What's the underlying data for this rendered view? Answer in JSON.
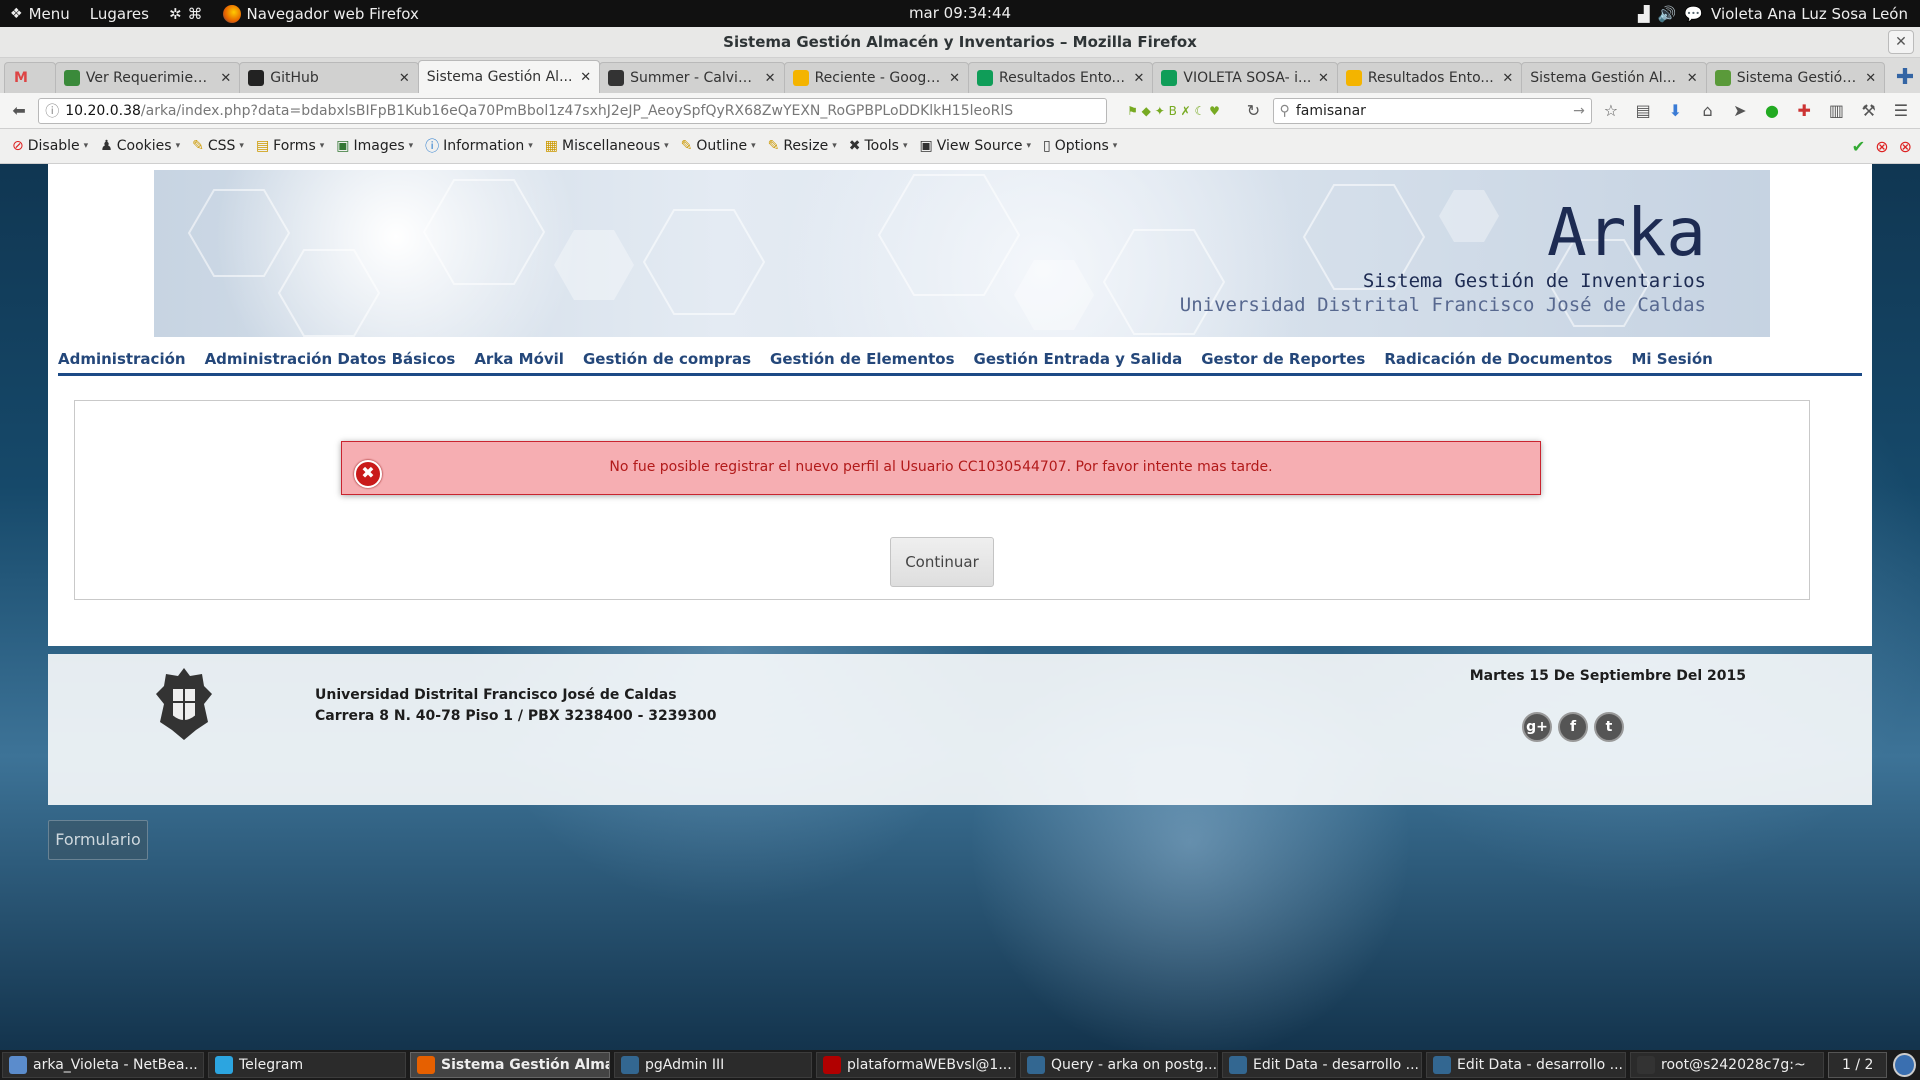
{
  "panel": {
    "menu_label": "Menu",
    "places_label": "Lugares",
    "app_label": "Navegador web Firefox",
    "clock": "mar 09:34:44",
    "user": "Violeta Ana Luz Sosa León"
  },
  "window": {
    "title": "Sistema Gestión Almacén y Inventarios – Mozilla Firefox",
    "close": "✕"
  },
  "tabs": [
    {
      "title": "",
      "icon_color": "#ffffff",
      "icon": "gmail-icon",
      "close": ""
    },
    {
      "title": "Ver Requerimien...",
      "icon_color": "#3a8a3a",
      "icon": "puzzle-icon",
      "close": "✕"
    },
    {
      "title": "GitHub",
      "icon_color": "#222222",
      "icon": "github-icon",
      "close": "✕"
    },
    {
      "title": "Sistema Gestión Al...",
      "icon_color": "#f5f5f4",
      "icon": "",
      "close": "✕",
      "active": true
    },
    {
      "title": "Summer - Calvin ...",
      "icon_color": "#333333",
      "icon": "media-icon",
      "close": "✕"
    },
    {
      "title": "Reciente - Googl...",
      "icon_color": "#f4b400",
      "icon": "drive-icon",
      "close": "✕"
    },
    {
      "title": "Resultados Ento...",
      "icon_color": "#0f9d58",
      "icon": "sheets-icon",
      "close": "✕"
    },
    {
      "title": "VIOLETA SOSA- i...",
      "icon_color": "#0f9d58",
      "icon": "sheets-icon",
      "close": "✕"
    },
    {
      "title": "Resultados Ento...",
      "icon_color": "#f4b400",
      "icon": "drive-icon",
      "close": "✕"
    },
    {
      "title": "Sistema Gestión Al...",
      "icon_color": "#d1d1d0",
      "icon": "",
      "close": "✕"
    },
    {
      "title": "Sistema Gestión ...",
      "icon_color": "#5a9a3a",
      "icon": "pinwheel-icon",
      "close": "✕"
    }
  ],
  "navbar": {
    "url_host": "10.20.0.38",
    "url_path": "/arka/index.php?data=bdabxlsBIFpB1Kub16eQa70PmBbol1z47sxhJ2eJP_AeoySpfQyRX68ZwYEXN_RoGPBPLoDDKlkH15leoRlS",
    "search_value": "famisanar"
  },
  "devbar": {
    "items": [
      "Disable",
      "Cookies",
      "CSS",
      "Forms",
      "Images",
      "Information",
      "Miscellaneous",
      "Outline",
      "Resize",
      "Tools",
      "View Source",
      "Options"
    ]
  },
  "banner": {
    "title": "Arka",
    "subtitle": "Sistema Gestión de Inventarios",
    "institution": "Universidad Distrital Francisco José de Caldas"
  },
  "mainnav": [
    "Administración",
    "Administración Datos Básicos",
    "Arka Móvil",
    "Gestión de compras",
    "Gestión de Elementos",
    "Gestión Entrada y Salida",
    "Gestor de Reportes",
    "Radicación de Documentos",
    "Mi Sesión"
  ],
  "error": {
    "icon": "✖",
    "message": "No fue posible registrar el nuevo perfil al Usuario CC1030544707. Por favor intente mas tarde."
  },
  "continue_label": "Continuar",
  "footer": {
    "org_name": "Universidad Distrital Francisco José de Caldas",
    "address": "Carrera 8 N. 40-78 Piso 1 / PBX 3238400 - 3239300",
    "date": "Martes 15 De Septiembre Del 2015",
    "social": [
      "g+",
      "f",
      "t"
    ]
  },
  "formulario_label": "Formulario",
  "taskbar": {
    "items": [
      {
        "label": "arka_Violeta - NetBea...",
        "color": "#5b8ccc",
        "icon": "netbeans-icon"
      },
      {
        "label": "Telegram",
        "color": "#2ca5e0",
        "icon": "telegram-icon"
      },
      {
        "label": "Sistema Gestión Alma...",
        "color": "#e66000",
        "icon": "firefox-icon",
        "active": true
      },
      {
        "label": "pgAdmin III",
        "color": "#336791",
        "icon": "pgadmin-icon"
      },
      {
        "label": "plataformaWEBvsl@1...",
        "color": "#b10000",
        "icon": "filezilla-icon"
      },
      {
        "label": "Query - arka on postg...",
        "color": "#336791",
        "icon": "pgadmin-icon"
      },
      {
        "label": "Edit Data - desarrollo ...",
        "color": "#336791",
        "icon": "pgadmin-icon"
      },
      {
        "label": "Edit Data - desarrollo ...",
        "color": "#336791",
        "icon": "pgadmin-icon"
      },
      {
        "label": "root@s242028c7g:~",
        "color": "#333333",
        "icon": "terminal-icon"
      }
    ],
    "workspace": "1 / 2"
  }
}
